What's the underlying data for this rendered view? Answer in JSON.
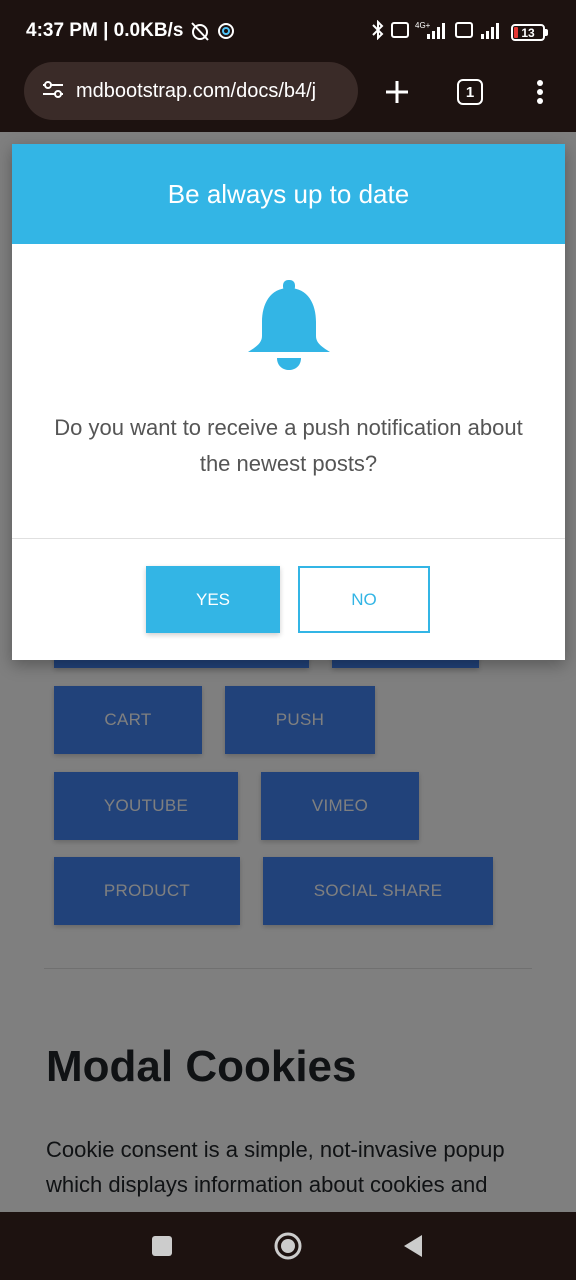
{
  "status_bar": {
    "time_speed": "4:37 PM | 0.0KB/s",
    "battery": "13",
    "network_label": "4G+"
  },
  "browser": {
    "url": "mdbootstrap.com/docs/b4/j",
    "tab_count": "1"
  },
  "page": {
    "buttons": [
      "CART",
      "PUSH",
      "YOUTUBE",
      "VIMEO",
      "PRODUCT",
      "SOCIAL SHARE"
    ],
    "heading": "Modal Cookies",
    "paragraph": "Cookie consent is a simple, not-invasive popup which displays information about cookies and"
  },
  "modal": {
    "title": "Be always up to date",
    "message": "Do you want to receive a push notification about the newest posts?",
    "yes_label": "YES",
    "no_label": "NO"
  },
  "colors": {
    "accent": "#33b5e5",
    "page_button": "#4285f4",
    "system_bar": "#1d1210"
  }
}
